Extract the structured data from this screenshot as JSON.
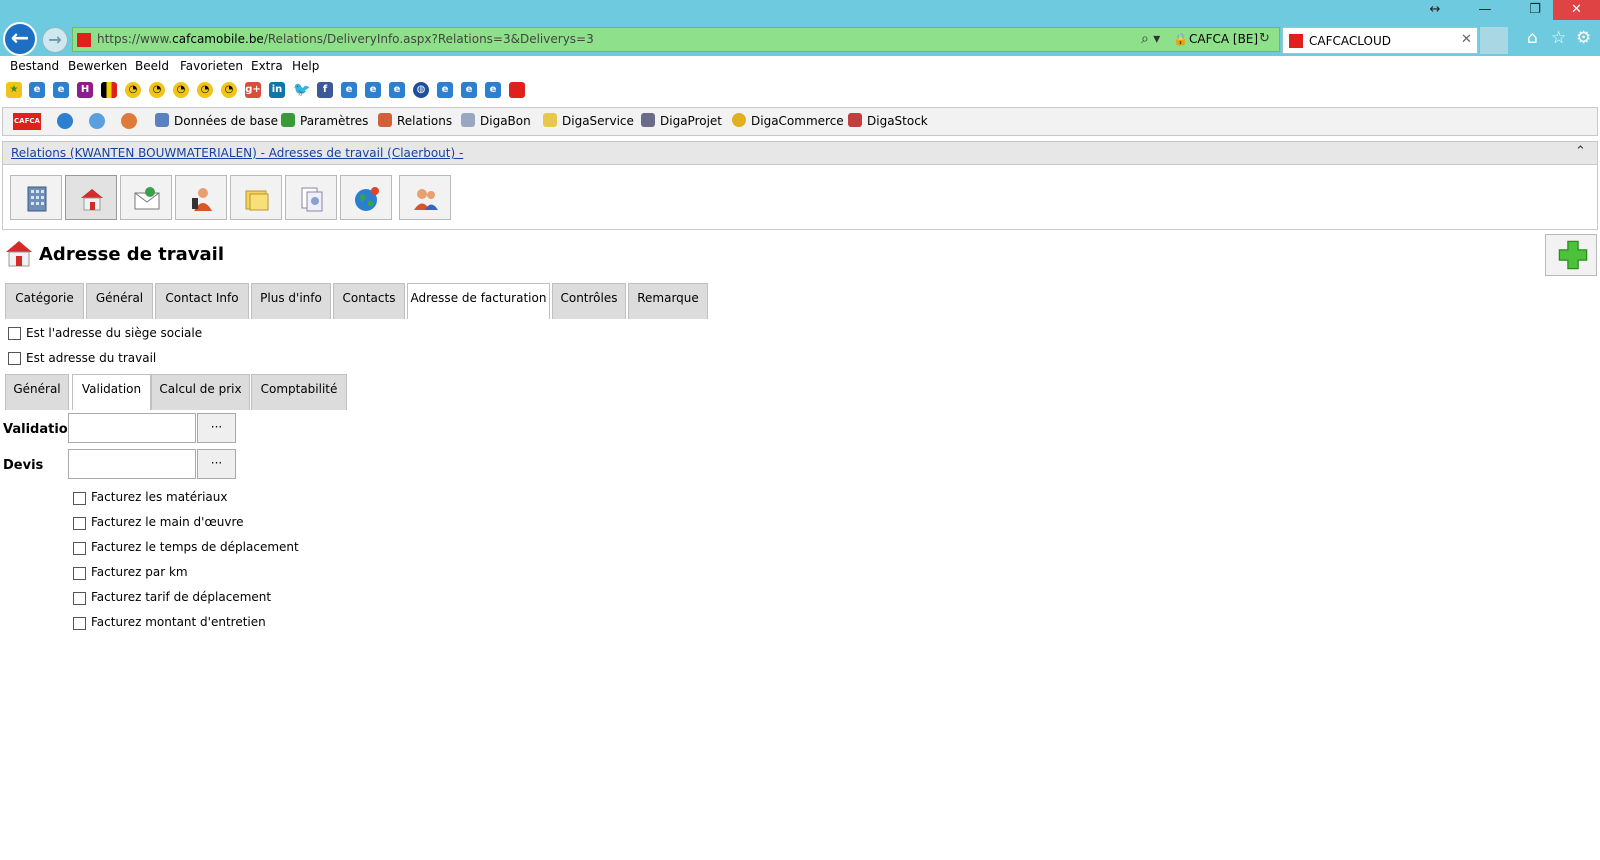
{
  "browser": {
    "url_prefix": "https://www.",
    "url_domain": "cafcamobile.be",
    "url_path": "/Relations/DeliveryInfo.aspx?Relations=3&Deliverys=3",
    "site_identity": "CAFCA [BE]",
    "tab_title": "CAFCACLOUD",
    "window_controls": [
      "↔",
      "—",
      "❐",
      "✕"
    ]
  },
  "menu": [
    "Bestand",
    "Bewerken",
    "Beeld",
    "Favorieten",
    "Extra",
    "Help"
  ],
  "app_toolbar": {
    "logo_text": "CAFCA",
    "items": [
      "Données de base",
      "Paramètres",
      "Relations",
      "DigaBon",
      "DigaService",
      "DigaProjet",
      "DigaCommerce",
      "DigaStock"
    ]
  },
  "breadcrumb": "Relations (KWANTEN BOUWMATERIALEN) - Adresses de travail (Claerbout) -",
  "page_title": "Adresse de travail",
  "main_tabs": [
    "Catégorie",
    "Général",
    "Contact Info",
    "Plus d'info",
    "Contacts",
    "Adresse de facturation",
    "Contrôles",
    "Remarque"
  ],
  "main_tabs_active": "Adresse de facturation",
  "top_checkboxes": [
    "Est l'adresse du siège sociale",
    "Est adresse du travail"
  ],
  "sub_tabs": [
    "Général",
    "Validation",
    "Calcul de prix",
    "Comptabilité"
  ],
  "sub_tabs_active": "Validation",
  "fields": {
    "validation_label": "Validation",
    "validation_value": "",
    "devis_label": "Devis",
    "devis_value": "",
    "browse_label": "···"
  },
  "invoice_checkboxes": [
    "Facturez les matériaux",
    "Facturez le main d'œuvre",
    "Facturez le temps de déplacement",
    "Facturez par km",
    "Facturez tarif de déplacement",
    "Facturez montant d'entretien"
  ],
  "colors": {
    "chrome": "#6ecbdf",
    "url_secure": "#8fe08a",
    "brand_red": "#e0201b",
    "link": "#1a3ea3"
  }
}
